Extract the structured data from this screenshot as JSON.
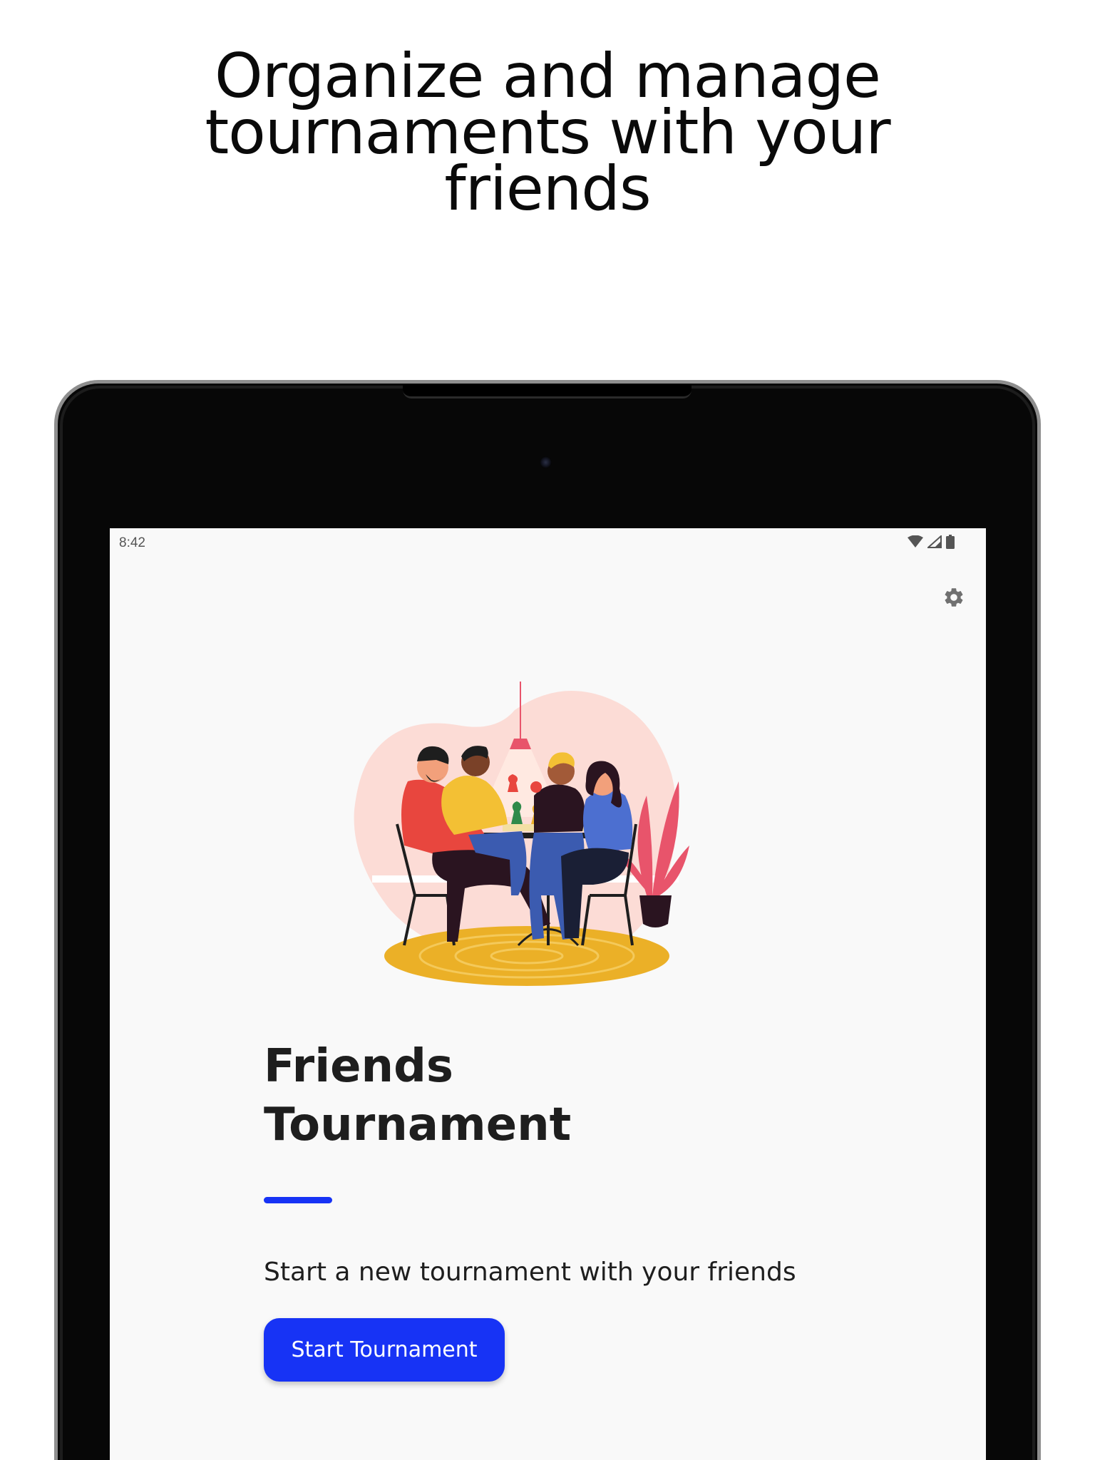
{
  "promo": {
    "headline_lines": [
      "Organize and manage",
      "tournaments with your",
      "friends"
    ]
  },
  "status_bar": {
    "time": "8:42",
    "icons": [
      "wifi-icon",
      "cellular-signal-icon",
      "battery-icon"
    ]
  },
  "toolbar": {
    "settings_icon": "gear-icon"
  },
  "hero": {
    "illustration": "friends-playing-board-game-illustration"
  },
  "main": {
    "title_lines": [
      "Friends",
      "Tournament"
    ],
    "subtitle": "Start a new tournament with your friends",
    "start_button_label": "Start Tournament"
  },
  "colors": {
    "accent": "#1733f5",
    "screen_background": "#f9f9f9",
    "text_primary": "#1e1e1e"
  }
}
